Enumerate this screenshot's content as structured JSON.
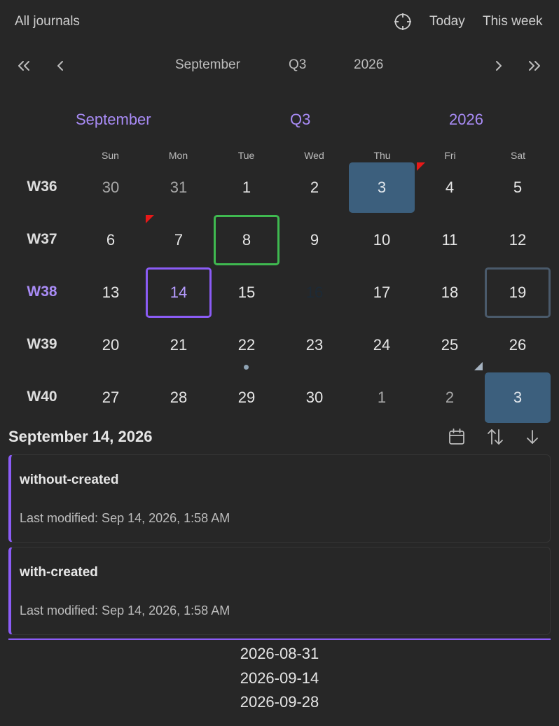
{
  "toolbar": {
    "all_journals": "All journals",
    "today": "Today",
    "this_week": "This week"
  },
  "nav": {
    "month": "September",
    "quarter": "Q3",
    "year": "2026"
  },
  "header": {
    "month": "September",
    "quarter": "Q3",
    "year": "2026"
  },
  "weekdays": [
    "Sun",
    "Mon",
    "Tue",
    "Wed",
    "Thu",
    "Fri",
    "Sat"
  ],
  "weeks": [
    {
      "label": "W36",
      "days": [
        "30",
        "31",
        "1",
        "2",
        "3",
        "4",
        "5"
      ]
    },
    {
      "label": "W37",
      "days": [
        "6",
        "7",
        "8",
        "9",
        "10",
        "11",
        "12"
      ]
    },
    {
      "label": "W38",
      "days": [
        "13",
        "14",
        "15",
        "16",
        "17",
        "18",
        "19"
      ]
    },
    {
      "label": "W39",
      "days": [
        "20",
        "21",
        "22",
        "23",
        "24",
        "25",
        "26"
      ]
    },
    {
      "label": "W40",
      "days": [
        "27",
        "28",
        "29",
        "30",
        "1",
        "2",
        "3"
      ]
    }
  ],
  "detail": {
    "date_title": "September 14, 2026",
    "notes": [
      {
        "title": "without-created",
        "meta": "Last modified: Sep 14, 2026, 1:58 AM"
      },
      {
        "title": "with-created",
        "meta": "Last modified: Sep 14, 2026, 1:58 AM"
      }
    ]
  },
  "date_list": [
    "2026-08-31",
    "2026-09-14",
    "2026-09-28"
  ],
  "colors": {
    "accent": "#8b5cf6",
    "today": "#3fb950",
    "filled": "#3c5f7d",
    "flag": "#e81818"
  }
}
